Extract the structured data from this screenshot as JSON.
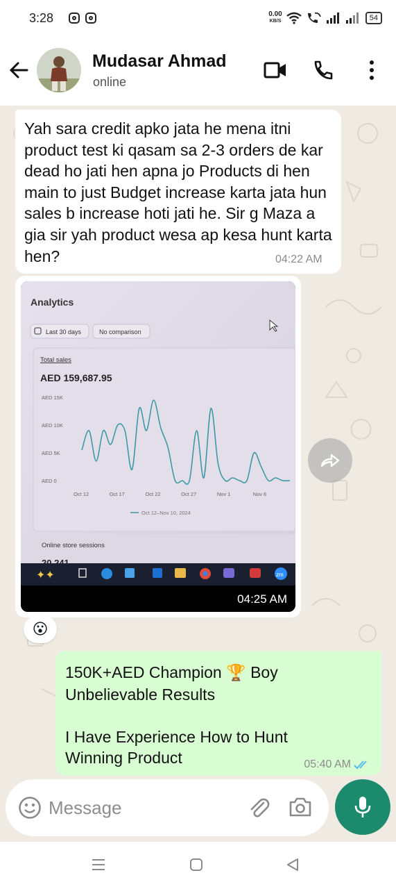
{
  "status_bar": {
    "time": "3:28",
    "net_speed": "0.00",
    "net_unit": "KB/S",
    "battery": "54"
  },
  "header": {
    "contact_name": "Mudasar Ahmad",
    "contact_status": "online"
  },
  "messages": {
    "incoming_text": {
      "text": "Yah sara credit apko jata he mena itni product test ki qasam sa 2-3 orders de kar dead ho jati hen apna jo Products di hen main to just Budget increase karta jata hun sales b increase hoti jati he. Sir g Maza a gia sir yah product wesa ap kesa hunt karta hen?",
      "time": "04:22 AM"
    },
    "incoming_image": {
      "time": "04:25 AM",
      "reaction": "😮",
      "screenshot": {
        "title": "Analytics",
        "filter_date": "Last 30 days",
        "filter_compare": "No comparison",
        "card_label": "Total sales",
        "total_value": "AED 159,687.95",
        "legend": "Oct 12–Nov 10, 2024",
        "sessions_label": "Online store sessions",
        "sessions_value": "20,241"
      }
    },
    "outgoing": {
      "line1_a": "150K+AED Champion ",
      "line1_emoji": "🏆",
      "line1_b": " Boy",
      "line2": "Unbelievable Results",
      "line3": "I Have Experience How to Hunt",
      "line4": "Winning Product",
      "time": "05:40 AM"
    }
  },
  "composer": {
    "placeholder": "Message"
  },
  "colors": {
    "accent_green": "#1c8a6c",
    "outgoing_bubble": "#d9fdd3",
    "read_ticks": "#53bdeb",
    "chart_line": "#3a9aa5"
  },
  "chart_data": {
    "type": "line",
    "title": "Total sales",
    "xlabel": "",
    "ylabel": "",
    "x_ticks": [
      "Oct 12",
      "Oct 17",
      "Oct 22",
      "Oct 27",
      "Nov 1",
      "Nov 6"
    ],
    "y_ticks": [
      "AED 0",
      "AED 5K",
      "AED 10K",
      "AED 15K"
    ],
    "ylim": [
      0,
      16000
    ],
    "grid": false,
    "legend_position": "bottom",
    "series": [
      {
        "name": "Oct 12–Nov 10, 2024",
        "x": [
          "Oct 12",
          "Oct 13",
          "Oct 14",
          "Oct 15",
          "Oct 16",
          "Oct 17",
          "Oct 18",
          "Oct 19",
          "Oct 20",
          "Oct 21",
          "Oct 22",
          "Oct 23",
          "Oct 24",
          "Oct 25",
          "Oct 26",
          "Oct 27",
          "Oct 28",
          "Oct 29",
          "Oct 30",
          "Oct 31",
          "Nov 1",
          "Nov 2",
          "Nov 3",
          "Nov 4",
          "Nov 5",
          "Nov 6",
          "Nov 7",
          "Nov 8",
          "Nov 9",
          "Nov 10"
        ],
        "values": [
          5500,
          9000,
          3500,
          9000,
          6500,
          10000,
          9000,
          2000,
          13000,
          9000,
          14500,
          9500,
          6000,
          0,
          0,
          0,
          9000,
          500,
          13000,
          3000,
          0,
          500,
          0,
          0,
          5000,
          2500,
          0,
          500,
          0,
          0
        ]
      }
    ]
  },
  "taskbar": {
    "label": "zm"
  }
}
